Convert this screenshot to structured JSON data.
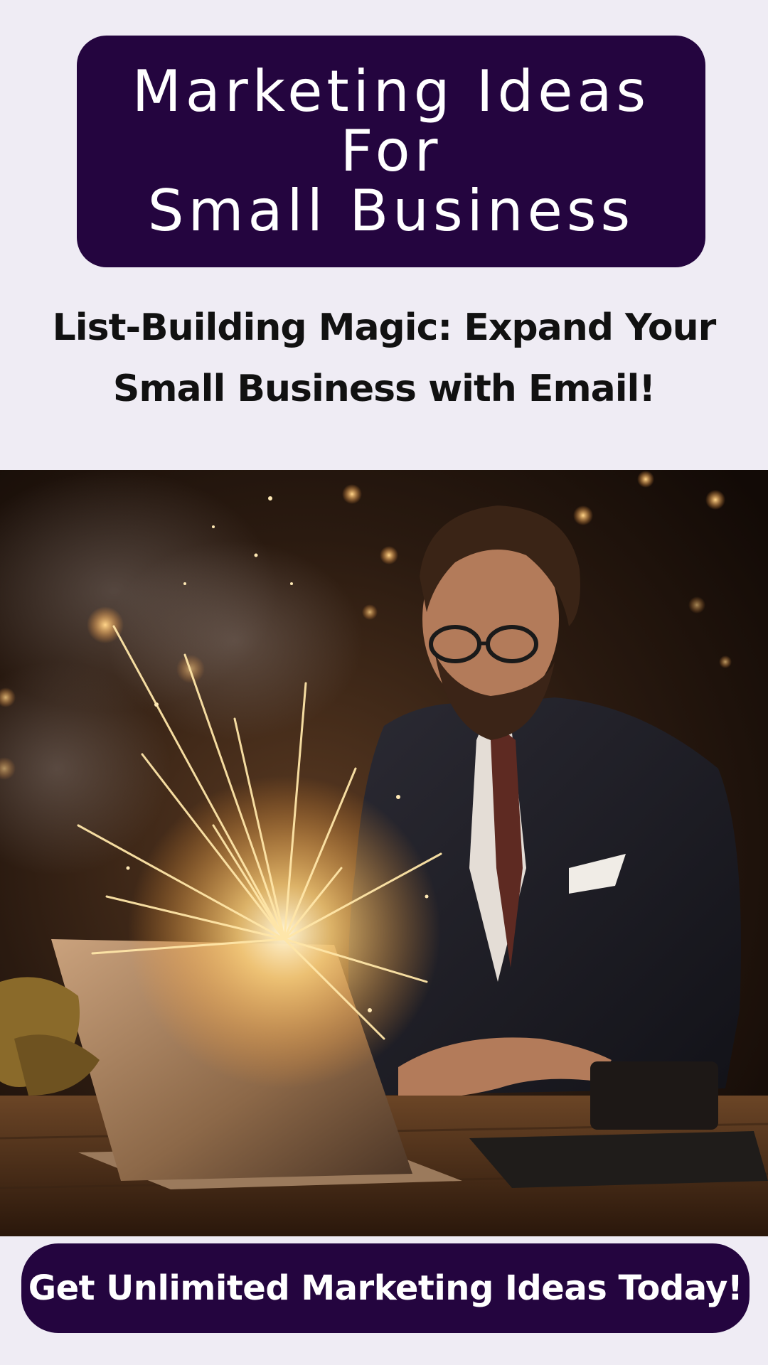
{
  "header": {
    "title_lines": [
      "Marketing Ideas",
      "For",
      "Small Business"
    ]
  },
  "subtitle": {
    "lines": [
      "List-Building Magic: Expand Your",
      "Small Business with Email!"
    ]
  },
  "hero": {
    "description_icon": "man-at-laptop-with-sparks-image"
  },
  "cta": {
    "label": "Get Unlimited Marketing Ideas Today!"
  },
  "colors": {
    "page_background": "#efecf4",
    "brand_purple": "#24053f",
    "heading_text": "#111111",
    "button_text": "#ffffff"
  }
}
